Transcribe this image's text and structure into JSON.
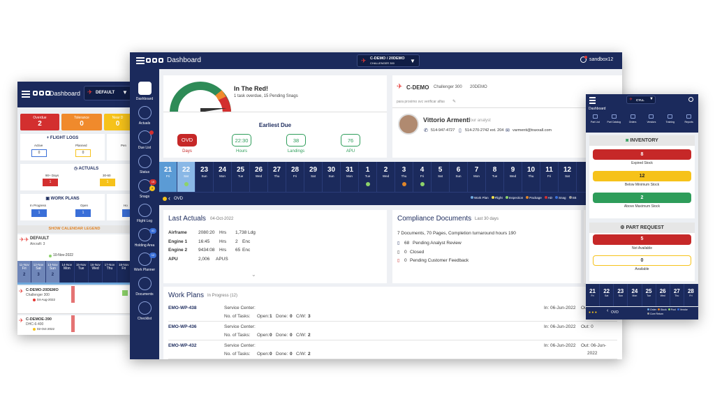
{
  "left_window": {
    "title": "Dashboard",
    "dropdown": "DEFAULT",
    "tiles": [
      {
        "label": "Overdue",
        "value": "2",
        "color": "#d32f2f"
      },
      {
        "label": "Tolerance",
        "value": "0",
        "color": "#f08a2c"
      },
      {
        "label": "Near D",
        "value": "0",
        "color": "#f6c21a"
      }
    ],
    "flight_logs": {
      "title": "FLIGHT LOGS",
      "cols": [
        {
          "label": "Active",
          "value": "0"
        },
        {
          "label": "Planned",
          "value": "0"
        },
        {
          "label": "Pen",
          "value": ""
        }
      ]
    },
    "actuals": {
      "title": "ACTUALS",
      "cols": [
        {
          "label": "90+ Days",
          "value": "1"
        },
        {
          "label": "30-60",
          "value": "1"
        }
      ]
    },
    "work_plans": {
      "title": "WORK PLANS",
      "cols": [
        {
          "label": "In Progress",
          "value": "1"
        },
        {
          "label": "Open",
          "value": "1"
        },
        {
          "label": "Ho",
          "value": ""
        }
      ]
    },
    "calendar_legend": "SHOW CALENDAR LEGEND",
    "default_block": {
      "name": "DEFAULT",
      "sub": "Aircraft: 3",
      "date": "10-Nov-2022"
    },
    "days": [
      {
        "n": "11-Nov",
        "d": "Fri",
        "v": "2"
      },
      {
        "n": "12-Nov",
        "d": "Sat",
        "v": "3"
      },
      {
        "n": "13-Nov",
        "d": "Sun",
        "v": "2"
      },
      {
        "n": "14-Nov",
        "d": "Mon",
        "v": ""
      },
      {
        "n": "15-Nov",
        "d": "Tue",
        "v": ""
      },
      {
        "n": "16-Nov",
        "d": "Wed",
        "v": ""
      },
      {
        "n": "17-Nov",
        "d": "Thu",
        "v": ""
      },
      {
        "n": "18-Nov",
        "d": "Fri",
        "v": ""
      }
    ],
    "aircraft": [
      {
        "name": "C-DEMO-20DEMO",
        "type": "Challenger 300",
        "date": "04-Aug-2022"
      },
      {
        "name": "C-DEMOE-390",
        "type": "DHC-6-400",
        "date": "02-Oct-2022"
      }
    ]
  },
  "main": {
    "title": "Dashboard",
    "aircraft_select": {
      "name": "C-DEMO",
      "reg": "20DEMO",
      "type": "CHALLENGER 300"
    },
    "user": "sandbox12",
    "sidebar": [
      {
        "label": "Dashboard",
        "icon": "dashboard-icon"
      },
      {
        "label": "Actuals",
        "icon": "clock-icon"
      },
      {
        "label": "Due List",
        "icon": "hourglass-icon"
      },
      {
        "label": "Status",
        "icon": "check-icon"
      },
      {
        "label": "Snags",
        "icon": "wrench-icon",
        "badge1": "15",
        "badge2": "4"
      },
      {
        "label": "Flight Log",
        "icon": "book-icon"
      },
      {
        "label": "Holding Area",
        "icon": "inbox-icon",
        "badge1": "41"
      },
      {
        "label": "Work Planner",
        "icon": "clipboard-icon",
        "badge1": "12"
      },
      {
        "label": "Documents",
        "icon": "folder-icon"
      },
      {
        "label": "Checklist",
        "icon": "list-icon"
      }
    ],
    "status": {
      "headline": "In The Red!",
      "summary": "1 task overdue, 15 Pending Snags"
    },
    "earliest_due": {
      "title": "Earliest Due",
      "items": [
        {
          "value": "OVD",
          "label": "Days",
          "style": "red"
        },
        {
          "value": "22:30",
          "label": "Hours",
          "style": "green"
        },
        {
          "value": "38",
          "label": "Landings",
          "style": "green"
        },
        {
          "value": "76",
          "label": "APU",
          "style": "green"
        }
      ]
    },
    "aircraft_card": {
      "reg": "C-DEMO",
      "type": "Challenger 300",
      "serial": "20DEMO",
      "note": "para proximo svc verificar alfas"
    },
    "analyst": {
      "name": "Vittorio Armenti",
      "role": "Your analyst",
      "phone1": "514-947-4727",
      "phone2": "514-270-2742 ext. 204",
      "email": "varmenti@traxxall.com"
    },
    "calendar": [
      {
        "n": "21",
        "d": "Fri",
        "cls": "sel"
      },
      {
        "n": "22",
        "d": "Sat",
        "cls": "sel2",
        "dot": "#8dd36a"
      },
      {
        "n": "23",
        "d": "Sun"
      },
      {
        "n": "24",
        "d": "Mon"
      },
      {
        "n": "25",
        "d": "Tue"
      },
      {
        "n": "26",
        "d": "Wed"
      },
      {
        "n": "27",
        "d": "Thu"
      },
      {
        "n": "28",
        "d": "Fri"
      },
      {
        "n": "29",
        "d": "Sat"
      },
      {
        "n": "30",
        "d": "Sun"
      },
      {
        "n": "31",
        "d": "Mon"
      },
      {
        "n": "1",
        "d": "Tue",
        "dot": "#8dd36a"
      },
      {
        "n": "2",
        "d": "Wed"
      },
      {
        "n": "3",
        "d": "Thu",
        "dot": "#e0862a"
      },
      {
        "n": "4",
        "d": "Fri",
        "dot": "#8dd36a"
      },
      {
        "n": "5",
        "d": "Sat"
      },
      {
        "n": "6",
        "d": "Sun"
      },
      {
        "n": "7",
        "d": "Mon"
      },
      {
        "n": "8",
        "d": "Tue"
      },
      {
        "n": "9",
        "d": "Wed"
      },
      {
        "n": "10",
        "d": "Thu"
      },
      {
        "n": "11",
        "d": "Fri"
      },
      {
        "n": "12",
        "d": "Sat"
      }
    ],
    "ovd_label": "OVD",
    "legend": [
      {
        "label": "Work Plan",
        "color": "#6fa8dc"
      },
      {
        "label": "Flight",
        "color": "#f6e14a"
      },
      {
        "label": "Inspection",
        "color": "#8dd36a"
      },
      {
        "label": "Package",
        "color": "#e0862a"
      },
      {
        "label": "AD",
        "color": "#d32f2f"
      },
      {
        "label": "Snag",
        "color": "#3a6fd8"
      },
      {
        "label": "SB",
        "color": "#9e9e9e"
      }
    ],
    "last_actuals": {
      "title": "Last Actuals",
      "date": "04-Oct-2022",
      "rows": [
        {
          "label": "Airframe",
          "v1": "2080:20",
          "u1": "Hrs",
          "v2": "1,738",
          "u2": "Ldg"
        },
        {
          "label": "Engine 1",
          "v1": "16:45",
          "u1": "Hrs",
          "v2": "2",
          "u2": "Enc"
        },
        {
          "label": "Engine 2",
          "v1": "9434:08",
          "u1": "Hrs",
          "v2": "65",
          "u2": "Enc"
        },
        {
          "label": "APU",
          "v1": "2,006",
          "u1": "APUS",
          "v2": "",
          "u2": ""
        }
      ]
    },
    "compliance": {
      "title": "Compliance Documents",
      "period": "Last 30 days",
      "summary": "7 Documents, 70 Pages, Completion turnaround hours 190",
      "rows": [
        {
          "count": "68",
          "label": "Pending Analyst Review"
        },
        {
          "count": "0",
          "label": "Closed"
        },
        {
          "count": "0",
          "label": "Pending Customer Feedback"
        }
      ]
    },
    "work_plans": {
      "title": "Work Plans",
      "sub": "In Progress (12)",
      "rows": [
        {
          "id": "EMO-WP-438",
          "center": "Service Center:",
          "in": "In: 06-Jun-2022",
          "out": "Out: 0",
          "open": "1",
          "done": "0",
          "cw": "3"
        },
        {
          "id": "EMO-WP-436",
          "center": "Service Center:",
          "in": "In: 06-Jun-2022",
          "out": "Out: 0",
          "open": "0",
          "done": "0",
          "cw": "2"
        },
        {
          "id": "EMO-WP-432",
          "center": "Service Center:",
          "in": "In: 06-Jun-2022",
          "out": "Out: 06-Jun-",
          "out2": "2022",
          "open": "0",
          "done": "0",
          "cw": "2"
        }
      ],
      "tasks_label": "No. of Tasks:",
      "open_label": "Open:",
      "done_label": "Done:",
      "cw_label": "C/W:"
    }
  },
  "mobile": {
    "dropdown": "CYLL",
    "title": "Dashboard",
    "nav": [
      "Part List",
      "Part Catalog",
      "Orders",
      "Vendors",
      "Training",
      "Reports"
    ],
    "inventory": {
      "title": "INVENTORY",
      "items": [
        {
          "value": "8",
          "label": "Expired Stock",
          "color": "#c62828"
        },
        {
          "value": "12",
          "label": "Below Minimum Stock",
          "color": "#f6c21a"
        },
        {
          "value": "2",
          "label": "Above Maximum Stock",
          "color": "#2e9d5a"
        }
      ]
    },
    "part_request": {
      "title": "PART REQUEST",
      "items": [
        {
          "value": "5",
          "label": "Not Available",
          "color": "#c62828"
        },
        {
          "value": "0",
          "label": "Available",
          "color": "#fff"
        }
      ]
    },
    "days": [
      {
        "n": "21",
        "d": "Fri"
      },
      {
        "n": "22",
        "d": "Sat"
      },
      {
        "n": "23",
        "d": "Sun"
      },
      {
        "n": "24",
        "d": "Mon"
      },
      {
        "n": "25",
        "d": "Tue"
      },
      {
        "n": "26",
        "d": "Wed"
      },
      {
        "n": "27",
        "d": "Thu"
      },
      {
        "n": "28",
        "d": "Fri"
      }
    ],
    "ovd": "OVD",
    "legend": [
      "Order",
      "Stock",
      "Pool",
      "Vendor",
      "Core Return"
    ]
  }
}
